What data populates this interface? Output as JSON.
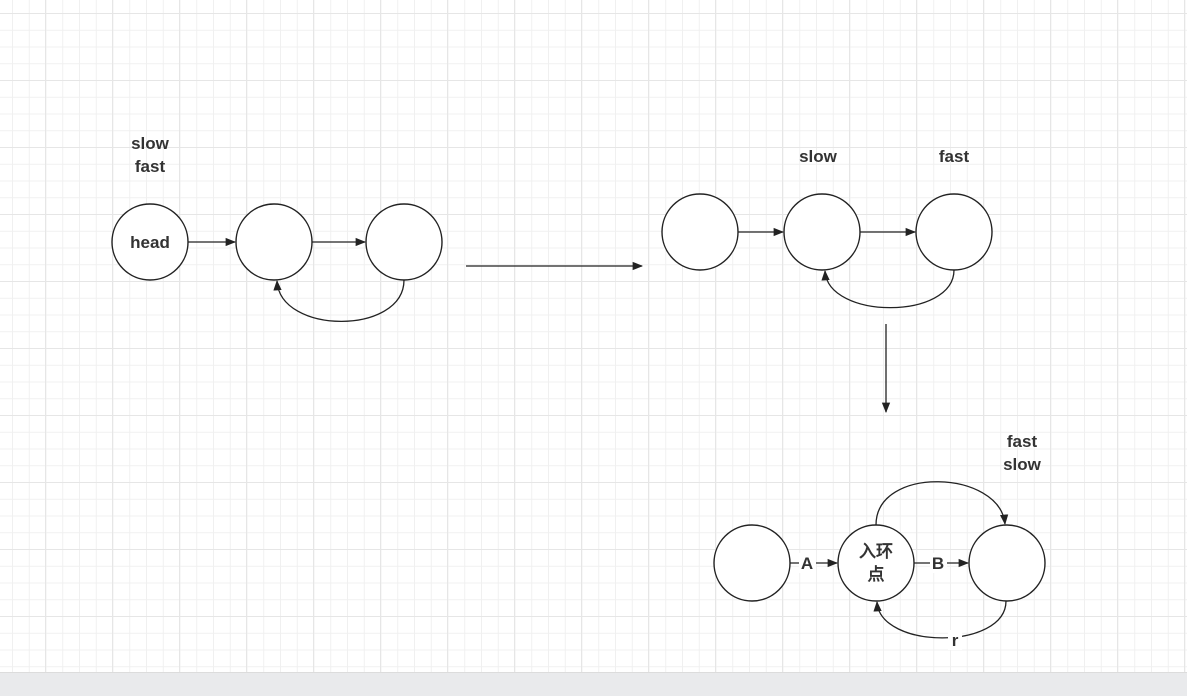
{
  "diagram": {
    "stage1": {
      "pointer_top": "slow",
      "pointer_bottom": "fast",
      "head_label": "head"
    },
    "stage2": {
      "slow_label": "slow",
      "fast_label": "fast"
    },
    "stage3": {
      "pointer_top": "fast",
      "pointer_bottom": "slow",
      "entry_label_line1": "入环",
      "entry_label_line2": "点",
      "edge_a": "A",
      "edge_b": "B",
      "edge_r": "r"
    }
  },
  "colors": {
    "stroke": "#222222",
    "grid": "#e6e6e6",
    "bottom_bar": "#e9eaec"
  }
}
